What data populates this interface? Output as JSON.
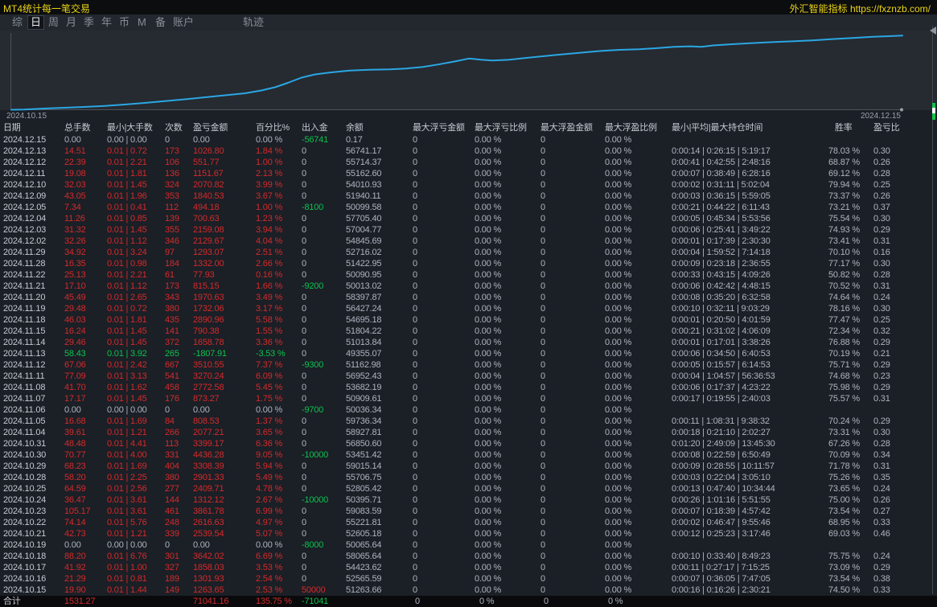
{
  "title_bar": {
    "title": "MT4统计每一笔交易",
    "brand": "外汇智能指标 https://fxznzb.com/"
  },
  "menu": {
    "items": [
      "综",
      "日",
      "周",
      "月",
      "季",
      "年",
      "币",
      "M",
      "备",
      "账户",
      "轨迹"
    ],
    "selected": "日"
  },
  "chart": {
    "start_label": "2024.10.15",
    "end_label": "2024.12.15",
    "line_color": "#2aa7e3",
    "points": [
      [
        14,
        136.5
      ],
      [
        30,
        136.2
      ],
      [
        55,
        135.0
      ],
      [
        80,
        134.0
      ],
      [
        105,
        133.0
      ],
      [
        130,
        131.8
      ],
      [
        155,
        130.0
      ],
      [
        180,
        128.0
      ],
      [
        205,
        125.8
      ],
      [
        230,
        123.5
      ],
      [
        255,
        121.0
      ],
      [
        280,
        118.5
      ],
      [
        305,
        116.0
      ],
      [
        325,
        112.5
      ],
      [
        342,
        108.5
      ],
      [
        358,
        103.0
      ],
      [
        375,
        96.5
      ],
      [
        392,
        92.5
      ],
      [
        412,
        90.0
      ],
      [
        435,
        87.8
      ],
      [
        460,
        86.8
      ],
      [
        485,
        86.2
      ],
      [
        505,
        85.2
      ],
      [
        525,
        83.4
      ],
      [
        545,
        80.2
      ],
      [
        565,
        76.5
      ],
      [
        583,
        72.8
      ],
      [
        598,
        74.3
      ],
      [
        612,
        75.2
      ],
      [
        632,
        74.4
      ],
      [
        652,
        72.3
      ],
      [
        672,
        70.3
      ],
      [
        695,
        68.0
      ],
      [
        720,
        65.8
      ],
      [
        745,
        63.5
      ],
      [
        770,
        62.0
      ],
      [
        795,
        61.2
      ],
      [
        815,
        60.0
      ],
      [
        838,
        58.3
      ],
      [
        858,
        57.6
      ],
      [
        872,
        58.3
      ],
      [
        888,
        56.4
      ],
      [
        910,
        55.0
      ],
      [
        935,
        53.6
      ],
      [
        960,
        52.4
      ],
      [
        985,
        51.4
      ],
      [
        1010,
        50.2
      ],
      [
        1035,
        48.6
      ],
      [
        1060,
        47.2
      ],
      [
        1085,
        45.8
      ],
      [
        1105,
        45.0
      ],
      [
        1122,
        44.3
      ]
    ]
  },
  "table": {
    "headers": [
      "日期",
      "总手数",
      "最小|大手数",
      "次数",
      "盈亏金额",
      "百分比%",
      "出入金",
      "余额",
      "最大浮亏金额",
      "最大浮亏比例",
      "最大浮盈金额",
      "最大浮盈比例",
      "最小|平均|最大持仓时间",
      "胜率",
      "盈亏比"
    ],
    "rows": [
      [
        "2024.12.15",
        "0.00",
        "0.00 | 0.00",
        "0",
        "0.00",
        "0.00 %",
        "-56741",
        "0.17",
        "0",
        "0.00 %",
        "0",
        "0.00 %",
        "",
        "",
        "",
        "z",
        "g"
      ],
      [
        "2024.12.13",
        "14.51",
        "0.01 | 0.72",
        "173",
        "1026.80",
        "1.84 %",
        "0",
        "56741.17",
        "0",
        "0.00 %",
        "0",
        "0.00 %",
        "0:00:14 | 0:26:15 | 5:19:17",
        "78.03 %",
        "0.30",
        "p",
        "z"
      ],
      [
        "2024.12.12",
        "22.39",
        "0.01 | 2.21",
        "106",
        "551.77",
        "1.00 %",
        "0",
        "55714.37",
        "0",
        "0.00 %",
        "0",
        "0.00 %",
        "0:00:41 | 0:42:55 | 2:48:16",
        "68.87 %",
        "0.26",
        "p",
        "z"
      ],
      [
        "2024.12.11",
        "19.08",
        "0.01 | 1.81",
        "136",
        "1151.67",
        "2.13 %",
        "0",
        "55162.60",
        "0",
        "0.00 %",
        "0",
        "0.00 %",
        "0:00:07 | 0:38:49 | 6:28:16",
        "69.12 %",
        "0.28",
        "p",
        "z"
      ],
      [
        "2024.12.10",
        "32.03",
        "0.01 | 1.45",
        "324",
        "2070.82",
        "3.99 %",
        "0",
        "54010.93",
        "0",
        "0.00 %",
        "0",
        "0.00 %",
        "0:00:02 | 0:31:11 | 5:02:04",
        "79.94 %",
        "0.25",
        "p",
        "z"
      ],
      [
        "2024.12.09",
        "43.05",
        "0.01 | 1.96",
        "353",
        "1840.53",
        "3.67 %",
        "0",
        "51940.11",
        "0",
        "0.00 %",
        "0",
        "0.00 %",
        "0:00:03 | 0:36:15 | 5:59:05",
        "73.37 %",
        "0.26",
        "p",
        "z"
      ],
      [
        "2024.12.05",
        "7.34",
        "0.01 | 0.41",
        "112",
        "494.18",
        "1.00 %",
        "-8100",
        "50099.58",
        "0",
        "0.00 %",
        "0",
        "0.00 %",
        "0:00:21 | 0:44:22 | 6:11:43",
        "73.21 %",
        "0.37",
        "p",
        "g"
      ],
      [
        "2024.12.04",
        "11.26",
        "0.01 | 0.85",
        "139",
        "700.63",
        "1.23 %",
        "0",
        "57705.40",
        "0",
        "0.00 %",
        "0",
        "0.00 %",
        "0:00:05 | 0:45:34 | 5:53:56",
        "75.54 %",
        "0.30",
        "p",
        "z"
      ],
      [
        "2024.12.03",
        "31.32",
        "0.01 | 1.45",
        "355",
        "2159.08",
        "3.94 %",
        "0",
        "57004.77",
        "0",
        "0.00 %",
        "0",
        "0.00 %",
        "0:00:06 | 0:25:41 | 3:49:22",
        "74.93 %",
        "0.29",
        "p",
        "z"
      ],
      [
        "2024.12.02",
        "32.26",
        "0.01 | 1.12",
        "346",
        "2129.67",
        "4.04 %",
        "0",
        "54845.69",
        "0",
        "0.00 %",
        "0",
        "0.00 %",
        "0:00:01 | 0:17:39 | 2:30:30",
        "73.41 %",
        "0.31",
        "p",
        "z"
      ],
      [
        "2024.11.29",
        "34.92",
        "0.01 | 3.24",
        "97",
        "1293.07",
        "2.51 %",
        "0",
        "52716.02",
        "0",
        "0.00 %",
        "0",
        "0.00 %",
        "0:00:04 | 1:59:52 | 7:14:18",
        "70.10 %",
        "0.16",
        "p",
        "z"
      ],
      [
        "2024.11.28",
        "16.35",
        "0.01 | 0.98",
        "184",
        "1332.00",
        "2.66 %",
        "0",
        "51422.95",
        "0",
        "0.00 %",
        "0",
        "0.00 %",
        "0:00:09 | 0:23:18 | 2:36:55",
        "77.17 %",
        "0.30",
        "p",
        "z"
      ],
      [
        "2024.11.22",
        "25.13",
        "0.01 | 2.21",
        "61",
        "77.93",
        "0.16 %",
        "0",
        "50090.95",
        "0",
        "0.00 %",
        "0",
        "0.00 %",
        "0:00:33 | 0:43:15 | 4:09:26",
        "50.82 %",
        "0.28",
        "p",
        "z"
      ],
      [
        "2024.11.21",
        "17.10",
        "0.01 | 1.12",
        "173",
        "815.15",
        "1.66 %",
        "-9200",
        "50013.02",
        "0",
        "0.00 %",
        "0",
        "0.00 %",
        "0:00:06 | 0:42:42 | 4:48:15",
        "70.52 %",
        "0.31",
        "p",
        "g"
      ],
      [
        "2024.11.20",
        "45.49",
        "0.01 | 2.65",
        "343",
        "1970.63",
        "3.49 %",
        "0",
        "58397.87",
        "0",
        "0.00 %",
        "0",
        "0.00 %",
        "0:00:08 | 0:35:20 | 6:32:58",
        "74.64 %",
        "0.24",
        "p",
        "z"
      ],
      [
        "2024.11.19",
        "29.48",
        "0.01 | 0.72",
        "380",
        "1732.06",
        "3.17 %",
        "0",
        "56427.24",
        "0",
        "0.00 %",
        "0",
        "0.00 %",
        "0:00:10 | 0:32:11 | 9:03:29",
        "78.16 %",
        "0.30",
        "p",
        "z"
      ],
      [
        "2024.11.18",
        "46.03",
        "0.01 | 1.81",
        "435",
        "2890.96",
        "5.58 %",
        "0",
        "54695.18",
        "0",
        "0.00 %",
        "0",
        "0.00 %",
        "0:00:01 | 0:20:50 | 4:01:59",
        "77.47 %",
        "0.25",
        "p",
        "z"
      ],
      [
        "2024.11.15",
        "16.24",
        "0.01 | 1.45",
        "141",
        "790.38",
        "1.55 %",
        "0",
        "51804.22",
        "0",
        "0.00 %",
        "0",
        "0.00 %",
        "0:00:21 | 0:31:02 | 4:06:09",
        "72.34 %",
        "0.32",
        "p",
        "z"
      ],
      [
        "2024.11.14",
        "29.46",
        "0.01 | 1.45",
        "372",
        "1658.78",
        "3.36 %",
        "0",
        "51013.84",
        "0",
        "0.00 %",
        "0",
        "0.00 %",
        "0:00:01 | 0:17:01 | 3:38:26",
        "76.88 %",
        "0.29",
        "p",
        "z"
      ],
      [
        "2024.11.13",
        "58.43",
        "0.01 | 3.92",
        "265",
        "-1807.91",
        "-3.53 %",
        "0",
        "49355.07",
        "0",
        "0.00 %",
        "0",
        "0.00 %",
        "0:00:06 | 0:34:50 | 6:40:53",
        "70.19 %",
        "0.21",
        "l",
        "z"
      ],
      [
        "2024.11.12",
        "67.06",
        "0.01 | 2.42",
        "667",
        "3510.55",
        "7.37 %",
        "-9300",
        "51162.98",
        "0",
        "0.00 %",
        "0",
        "0.00 %",
        "0:00:05 | 0:15:57 | 6:14:53",
        "75.71 %",
        "0.29",
        "p",
        "g"
      ],
      [
        "2024.11.11",
        "77.09",
        "0.01 | 3.13",
        "541",
        "3270.24",
        "6.09 %",
        "0",
        "56952.43",
        "0",
        "0.00 %",
        "0",
        "0.00 %",
        "0:00:04 | 1:04:57 | 56:36:53",
        "74.68 %",
        "0.23",
        "p",
        "z"
      ],
      [
        "2024.11.08",
        "41.70",
        "0.01 | 1.62",
        "458",
        "2772.58",
        "5.45 %",
        "0",
        "53682.19",
        "0",
        "0.00 %",
        "0",
        "0.00 %",
        "0:00:06 | 0:17:37 | 4:23:22",
        "75.98 %",
        "0.29",
        "p",
        "z"
      ],
      [
        "2024.11.07",
        "17.17",
        "0.01 | 1.45",
        "176",
        "873.27",
        "1.75 %",
        "0",
        "50909.61",
        "0",
        "0.00 %",
        "0",
        "0.00 %",
        "0:00:17 | 0:19:55 | 2:40:03",
        "75.57 %",
        "0.31",
        "p",
        "z"
      ],
      [
        "2024.11.06",
        "0.00",
        "0.00 | 0.00",
        "0",
        "0.00",
        "0.00 %",
        "-9700",
        "50036.34",
        "0",
        "0.00 %",
        "0",
        "0.00 %",
        "",
        "",
        "",
        "z",
        "g"
      ],
      [
        "2024.11.05",
        "16.68",
        "0.01 | 1.69",
        "84",
        "808.53",
        "1.37 %",
        "0",
        "59736.34",
        "0",
        "0.00 %",
        "0",
        "0.00 %",
        "0:00:11 | 1:08:31 | 9:38:32",
        "70.24 %",
        "0.29",
        "p",
        "z"
      ],
      [
        "2024.11.04",
        "39.61",
        "0.01 | 1.21",
        "266",
        "2077.21",
        "3.65 %",
        "0",
        "58927.81",
        "0",
        "0.00 %",
        "0",
        "0.00 %",
        "0:00:18 | 0:21:10 | 2:02:27",
        "73.31 %",
        "0.30",
        "p",
        "z"
      ],
      [
        "2024.10.31",
        "48.48",
        "0.01 | 4.41",
        "113",
        "3399.17",
        "6.36 %",
        "0",
        "56850.60",
        "0",
        "0.00 %",
        "0",
        "0.00 %",
        "0:01:20 | 2:49:09 | 13:45:30",
        "67.26 %",
        "0.28",
        "p",
        "z"
      ],
      [
        "2024.10.30",
        "70.77",
        "0.01 | 4.00",
        "331",
        "4436.28",
        "9.05 %",
        "-10000",
        "53451.42",
        "0",
        "0.00 %",
        "0",
        "0.00 %",
        "0:00:08 | 0:22:59 | 6:50:49",
        "70.09 %",
        "0.34",
        "p",
        "g"
      ],
      [
        "2024.10.29",
        "68.23",
        "0.01 | 1.69",
        "404",
        "3308.39",
        "5.94 %",
        "0",
        "59015.14",
        "0",
        "0.00 %",
        "0",
        "0.00 %",
        "0:00:09 | 0:28:55 | 10:11:57",
        "71.78 %",
        "0.31",
        "p",
        "z"
      ],
      [
        "2024.10.28",
        "58.20",
        "0.01 | 2.25",
        "380",
        "2901.33",
        "5.49 %",
        "0",
        "55706.75",
        "0",
        "0.00 %",
        "0",
        "0.00 %",
        "0:00:03 | 0:22:04 | 3:05:10",
        "75.26 %",
        "0.35",
        "p",
        "z"
      ],
      [
        "2024.10.25",
        "64.59",
        "0.01 | 2.56",
        "277",
        "2409.71",
        "4.78 %",
        "0",
        "52805.42",
        "0",
        "0.00 %",
        "0",
        "0.00 %",
        "0:00:13 | 0:47:40 | 10:34:44",
        "73.65 %",
        "0.24",
        "p",
        "z"
      ],
      [
        "2024.10.24",
        "36.47",
        "0.01 | 3.61",
        "144",
        "1312.12",
        "2.67 %",
        "-10000",
        "50395.71",
        "0",
        "0.00 %",
        "0",
        "0.00 %",
        "0:00:26 | 1:01:16 | 5:51:55",
        "75.00 %",
        "0.26",
        "p",
        "g"
      ],
      [
        "2024.10.23",
        "105.17",
        "0.01 | 3.61",
        "461",
        "3861.78",
        "6.99 %",
        "0",
        "59083.59",
        "0",
        "0.00 %",
        "0",
        "0.00 %",
        "0:00:07 | 0:18:39 | 4:57:42",
        "73.54 %",
        "0.27",
        "p",
        "z"
      ],
      [
        "2024.10.22",
        "74.14",
        "0.01 | 5.76",
        "248",
        "2616.63",
        "4.97 %",
        "0",
        "55221.81",
        "0",
        "0.00 %",
        "0",
        "0.00 %",
        "0:00:02 | 0:46:47 | 9:55:46",
        "68.95 %",
        "0.33",
        "p",
        "z"
      ],
      [
        "2024.10.21",
        "42.73",
        "0.01 | 1.21",
        "339",
        "2539.54",
        "5.07 %",
        "0",
        "52605.18",
        "0",
        "0.00 %",
        "0",
        "0.00 %",
        "0:00:12 | 0:25:23 | 3:17:46",
        "69.03 %",
        "0.46",
        "p",
        "z"
      ],
      [
        "2024.10.19",
        "0.00",
        "0.00 | 0.00",
        "0",
        "0.00",
        "0.00 %",
        "-8000",
        "50065.64",
        "0",
        "0.00 %",
        "0",
        "0.00 %",
        "",
        "",
        "",
        "z",
        "g"
      ],
      [
        "2024.10.18",
        "88.20",
        "0.01 | 6.76",
        "301",
        "3642.02",
        "6.69 %",
        "0",
        "58065.64",
        "0",
        "0.00 %",
        "0",
        "0.00 %",
        "0:00:10 | 0:33:40 | 8:49:23",
        "75.75 %",
        "0.24",
        "p",
        "z"
      ],
      [
        "2024.10.17",
        "41.92",
        "0.01 | 1.00",
        "327",
        "1858.03",
        "3.53 %",
        "0",
        "54423.62",
        "0",
        "0.00 %",
        "0",
        "0.00 %",
        "0:00:11 | 0:27:17 | 7:15:25",
        "73.09 %",
        "0.29",
        "p",
        "z"
      ],
      [
        "2024.10.16",
        "21.29",
        "0.01 | 0.81",
        "189",
        "1301.93",
        "2.54 %",
        "0",
        "52565.59",
        "0",
        "0.00 %",
        "0",
        "0.00 %",
        "0:00:07 | 0:36:05 | 7:47:05",
        "73.54 %",
        "0.38",
        "p",
        "z"
      ],
      [
        "2024.10.15",
        "19.90",
        "0.01 | 1.44",
        "149",
        "1263.65",
        "2.53 %",
        "50000",
        "51263.66",
        "0",
        "0.00 %",
        "0",
        "0.00 %",
        "0:00:16 | 0:16:26 | 2:30:21",
        "74.50 %",
        "0.33",
        "p",
        "r"
      ]
    ],
    "total": {
      "label": "合计",
      "lots": "1531.27",
      "pnl": "71041.16",
      "pct": "135.75 %",
      "inout": "-71041",
      "dd": "0",
      "ddpct": "0 %",
      "fp": "0",
      "fppct": "0 %"
    }
  },
  "colors": {
    "red": "#d42a2a",
    "green": "#0cc24e",
    "muted": "#aeb5bf",
    "bright": "#c6cbd3",
    "yellow": "#e9d414",
    "chart_line": "#2aa7e3"
  }
}
